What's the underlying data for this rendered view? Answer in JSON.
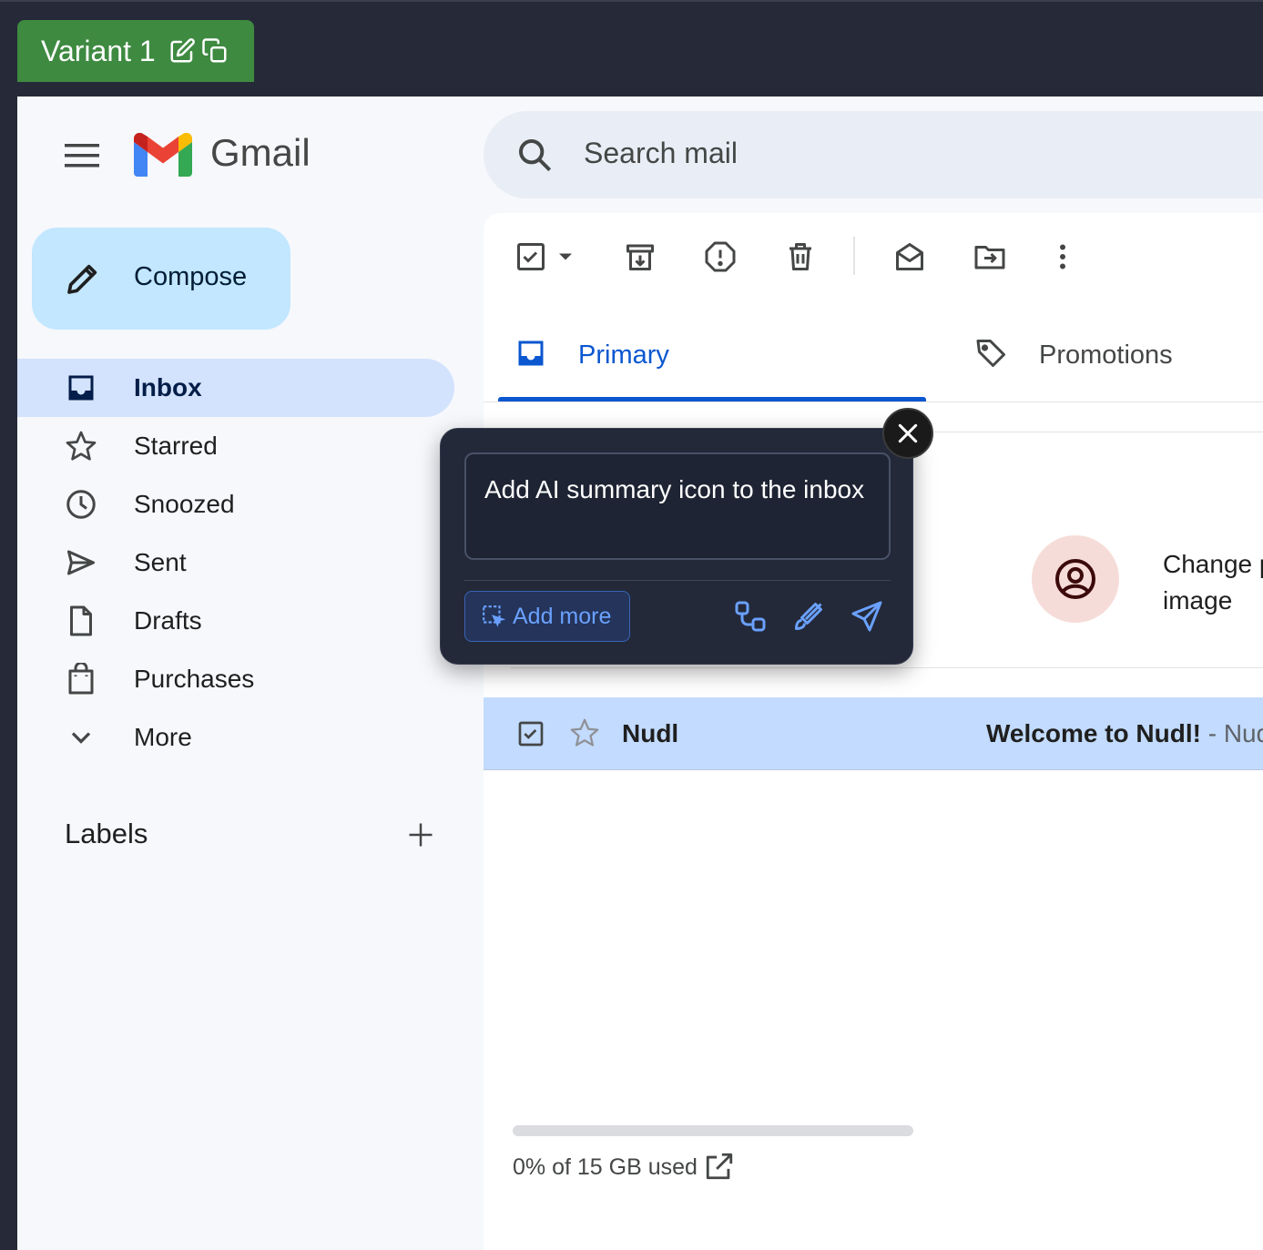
{
  "variant_tab": {
    "label": "Variant 1"
  },
  "header": {
    "logo_text": "Gmail",
    "search_placeholder": "Search mail"
  },
  "sidebar": {
    "compose_label": "Compose",
    "items": [
      {
        "label": "Inbox",
        "icon": "inbox-icon",
        "active": true
      },
      {
        "label": "Starred",
        "icon": "star-icon"
      },
      {
        "label": "Snoozed",
        "icon": "clock-icon"
      },
      {
        "label": "Sent",
        "icon": "send-icon"
      },
      {
        "label": "Drafts",
        "icon": "draft-icon"
      },
      {
        "label": "Purchases",
        "icon": "shopping-bag-icon"
      },
      {
        "label": "More",
        "icon": "chevron-down-icon"
      }
    ],
    "labels_heading": "Labels"
  },
  "tabs": [
    {
      "label": "Primary",
      "icon": "inbox-icon",
      "active": true
    },
    {
      "label": "Promotions",
      "icon": "tag-icon"
    }
  ],
  "promo_card": {
    "text": "Change p image"
  },
  "mail_rows": [
    {
      "sender": "Nudl",
      "subject": "Welcome to Nudl!",
      "snippet": " - Nud"
    }
  ],
  "storage": {
    "used_fraction": 0.0,
    "text": "0% of 15 GB used"
  },
  "popup": {
    "input_text": "Add AI summary icon to the inbox",
    "add_more_label": "Add more"
  },
  "colors": {
    "accent": "#0b57d0",
    "compose_bg": "#c2e7ff",
    "active_nav_bg": "#d3e3fd",
    "variant_tab_bg": "#3e8a41",
    "popup_bg": "#232939",
    "selected_row_bg": "#c2dbff"
  }
}
